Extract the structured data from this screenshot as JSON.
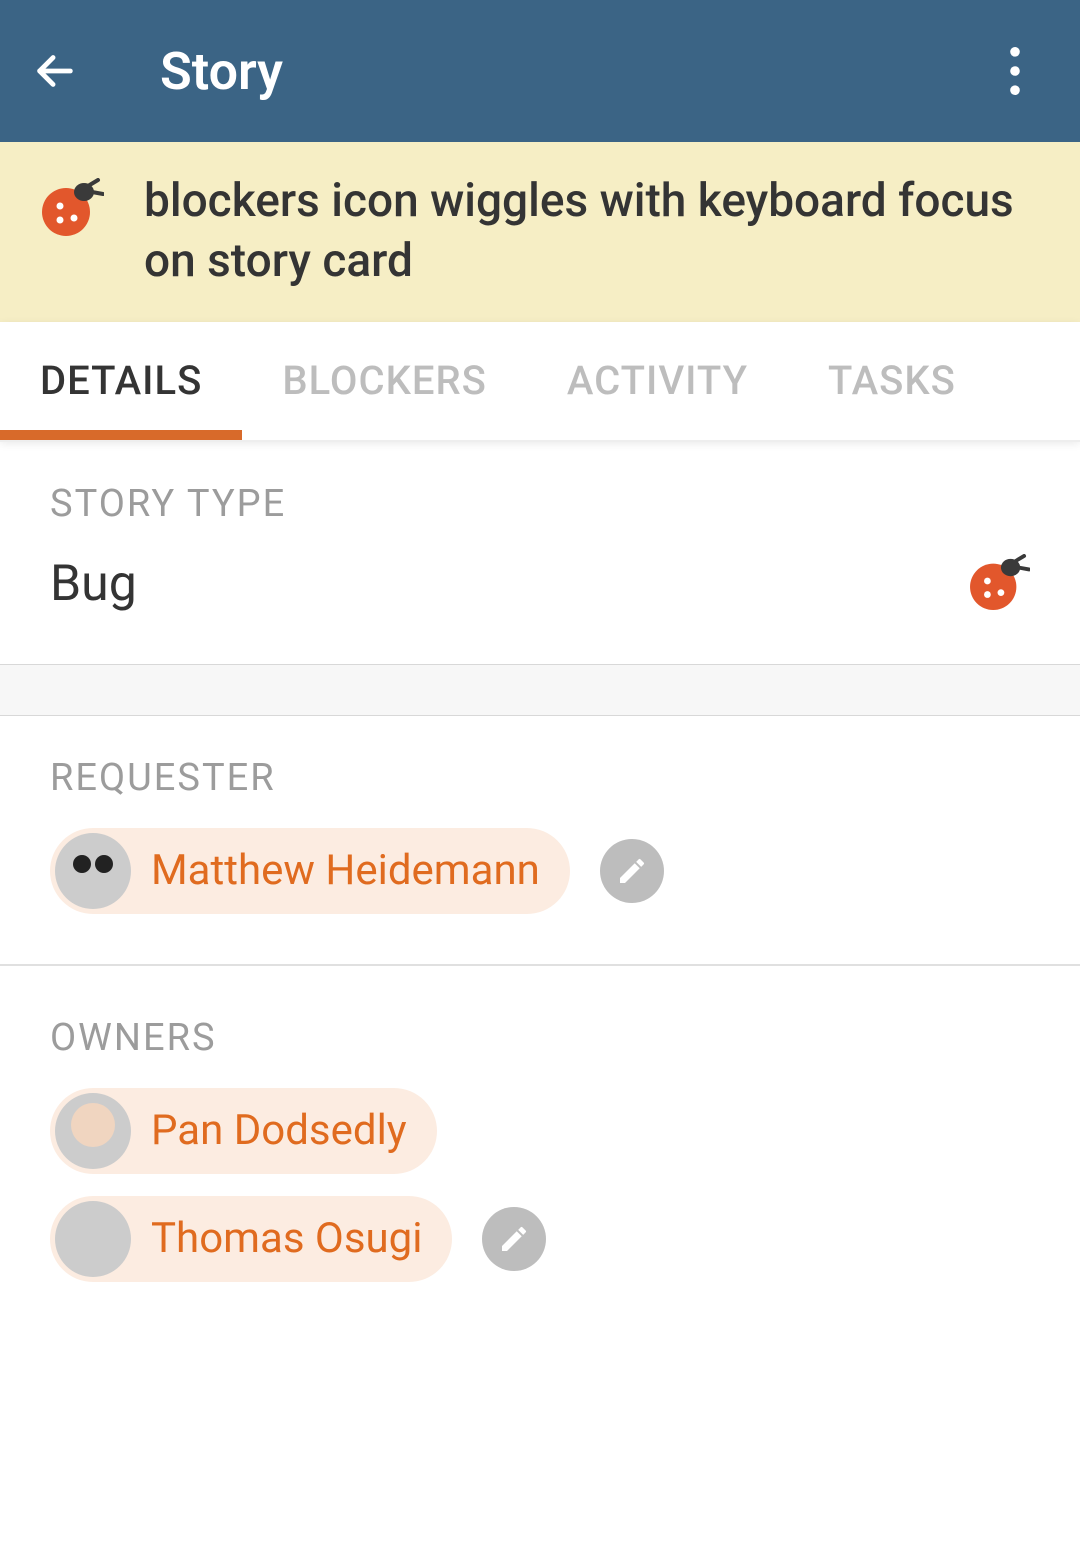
{
  "appbar": {
    "title": "Story"
  },
  "story": {
    "title": "blockers icon wiggles with keyboard focus on story card"
  },
  "tabs": [
    {
      "label": "DETAILS",
      "active": true
    },
    {
      "label": "BLOCKERS",
      "active": false
    },
    {
      "label": "ACTIVITY",
      "active": false
    },
    {
      "label": "TASKS",
      "active": false
    }
  ],
  "details": {
    "story_type_label": "STORY TYPE",
    "story_type_value": "Bug",
    "requester_label": "REQUESTER",
    "requester": {
      "name": "Matthew Heidemann"
    },
    "owners_label": "OWNERS",
    "owners": [
      {
        "name": "Pan Dodsedly"
      },
      {
        "name": "Thomas Osugi"
      }
    ]
  },
  "colors": {
    "appbar": "#3b6485",
    "accent": "#d86a2a",
    "chip_bg": "#fcece1",
    "chip_text": "#e06b1f"
  }
}
